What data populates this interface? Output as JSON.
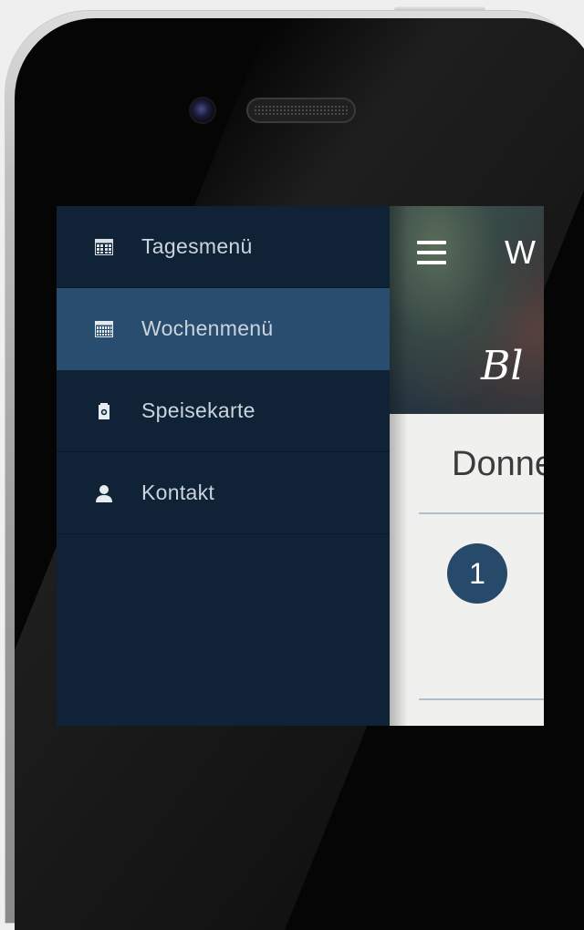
{
  "sidebar": {
    "items": [
      {
        "label": "Tagesmenü",
        "icon": "calendar-grid-icon",
        "active": false
      },
      {
        "label": "Wochenmenü",
        "icon": "calendar-week-icon",
        "active": true
      },
      {
        "label": "Speisekarte",
        "icon": "menu-card-icon",
        "active": false
      },
      {
        "label": "Kontakt",
        "icon": "person-icon",
        "active": false
      }
    ]
  },
  "header": {
    "title": "W",
    "brand": "Bl",
    "menu_icon": "hamburger-icon"
  },
  "main": {
    "day_heading": "Donne",
    "item_number": "1"
  },
  "colors": {
    "sidebar_bg": "#102235",
    "active_item_bg": "#294d6e",
    "accent_circle": "#27496a",
    "content_bg": "#f0f0ee"
  }
}
